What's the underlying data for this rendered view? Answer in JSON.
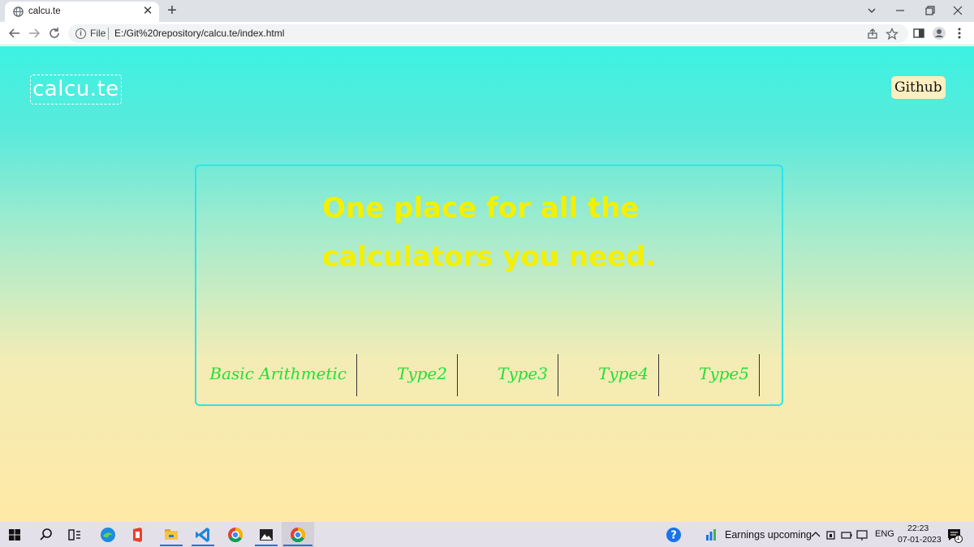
{
  "browser": {
    "tab_title": "calcu.te",
    "tab_close": "✕",
    "new_tab": "+",
    "scheme_label": "File",
    "url": "E:/Git%20repository/calcu.te/index.html",
    "info_glyph": "i",
    "icons": [
      "globe-icon",
      "back-arrow-icon",
      "forward-arrow-icon",
      "reload-icon",
      "share-icon",
      "star-icon",
      "sidebar-icon",
      "profile-icon",
      "menu-kebab-icon"
    ]
  },
  "site": {
    "logo": "calcu.te",
    "github_label": "Github",
    "headline": "One place for all the calculators you need.",
    "calculators": [
      "Basic Arithmetic",
      "Type2",
      "Type3",
      "Type4",
      "Type5"
    ]
  },
  "taskbar": {
    "news_text": "Earnings upcoming",
    "language": "ENG",
    "time": "22:23",
    "date": "07-01-2023",
    "notification_count": "1"
  },
  "colors": {
    "headline": "#f3f000",
    "calculator_text": "#22e03a",
    "card_border": "#2ee4e8",
    "github_bg": "#fbeec0"
  }
}
